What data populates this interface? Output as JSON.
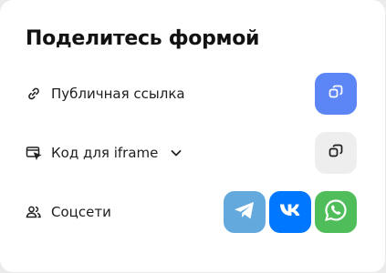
{
  "card": {
    "title": "Поделитесь формой"
  },
  "rows": {
    "public_link": {
      "label": "Публичная ссылка",
      "icon": "link-icon",
      "action_icon": "copy-icon",
      "action_color": "#5c86f5"
    },
    "iframe": {
      "label": "Код для iframe",
      "icon": "iframe-window-icon",
      "dropdown_icon": "chevron-down-icon",
      "action_icon": "copy-icon",
      "action_color": "#eeeeee"
    },
    "social": {
      "label": "Соцсети",
      "icon": "users-icon",
      "networks": [
        {
          "name": "Telegram",
          "icon": "telegram-icon",
          "color": "#63a9dd"
        },
        {
          "name": "VK",
          "icon": "vk-icon",
          "color": "#0077ff"
        },
        {
          "name": "WhatsApp",
          "icon": "whatsapp-icon",
          "color": "#4fbe5a"
        }
      ]
    }
  }
}
